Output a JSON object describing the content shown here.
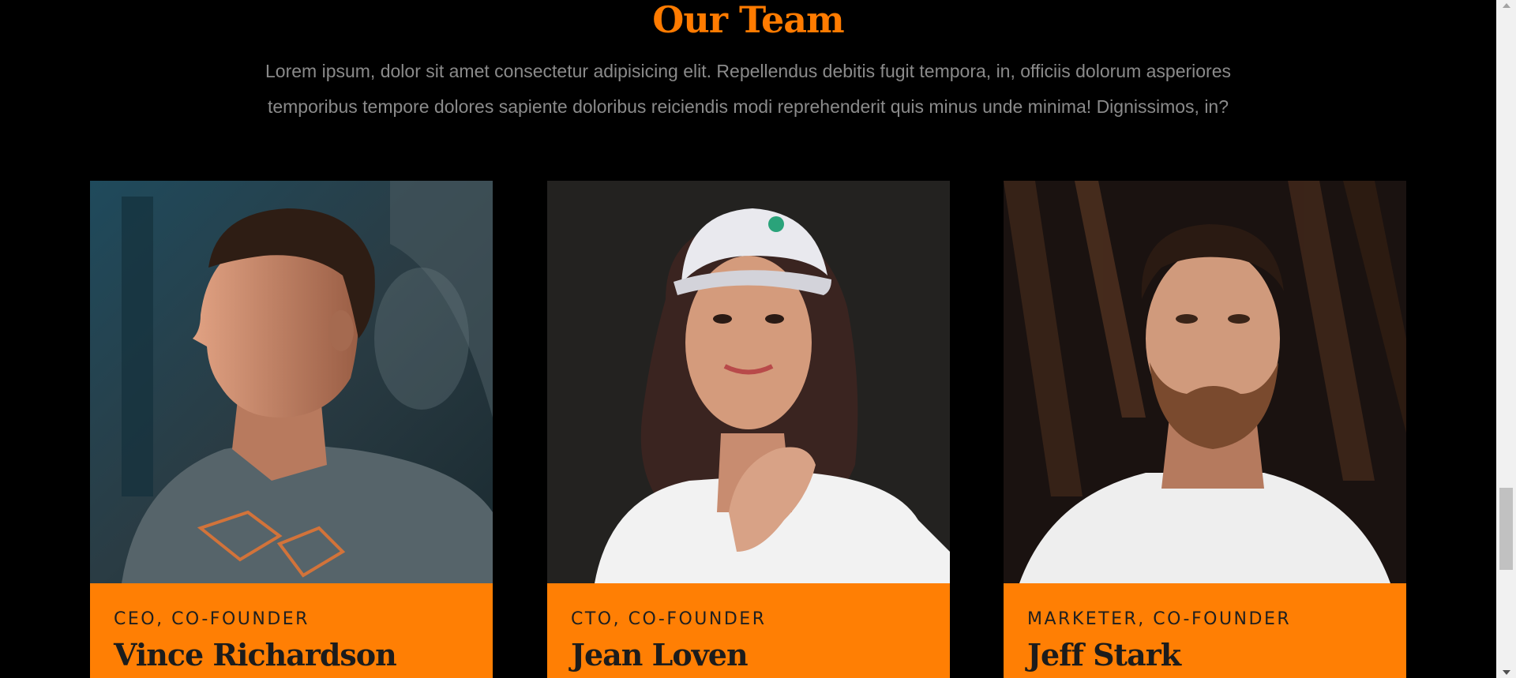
{
  "section": {
    "title": "Our Team",
    "intro": "Lorem ipsum, dolor sit amet consectetur adipisicing elit. Repellendus debitis fugit tempora, in, officiis dolorum asperiores temporibus tempore dolores sapiente doloribus reiciendis modi reprehenderit quis minus unde minima! Dignissimos, in?"
  },
  "team": [
    {
      "role": "CEO, CO-FOUNDER",
      "name": "Vince Richardson",
      "photo_icon": "portrait-man-profile"
    },
    {
      "role": "CTO, CO-FOUNDER",
      "name": "Jean Loven",
      "photo_icon": "portrait-woman-cap"
    },
    {
      "role": "MARKETER, CO-FOUNDER",
      "name": "Jeff Stark",
      "photo_icon": "portrait-man-beard"
    }
  ],
  "colors": {
    "background": "#000000",
    "accent": "#ff7b00",
    "card_info": "#ff7f04",
    "text_muted": "#8a8a8a",
    "text_dark": "#1c1c1c"
  }
}
